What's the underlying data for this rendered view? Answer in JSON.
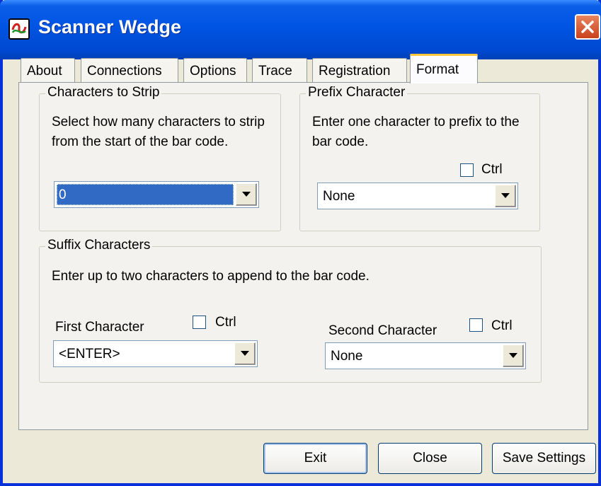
{
  "window": {
    "title": "Scanner Wedge"
  },
  "tabs": [
    {
      "label": "About"
    },
    {
      "label": "Connections"
    },
    {
      "label": "Options"
    },
    {
      "label": "Trace"
    },
    {
      "label": "Registration"
    },
    {
      "label": "Format",
      "active": true
    }
  ],
  "strip": {
    "legend": "Characters to Strip",
    "description": "Select how many characters to strip from the start of the bar code.",
    "value": "0"
  },
  "prefix": {
    "legend": "Prefix Character",
    "description": "Enter one character to prefix to the bar code.",
    "ctrl_label": "Ctrl",
    "ctrl_checked": false,
    "value": "None"
  },
  "suffix": {
    "legend": "Suffix Characters",
    "description": "Enter up to two characters to append to the bar code.",
    "first": {
      "label": "First Character",
      "ctrl_label": "Ctrl",
      "ctrl_checked": false,
      "value": "<ENTER>"
    },
    "second": {
      "label": "Second Character",
      "ctrl_label": "Ctrl",
      "ctrl_checked": false,
      "value": "None"
    }
  },
  "buttons": {
    "exit": "Exit",
    "close": "Close",
    "save": "Save Settings"
  },
  "colors": {
    "titlebar": "#0054e3",
    "selection": "#316ac5",
    "tab_highlight": "#ffc83c",
    "close_button": "#c9401c"
  }
}
